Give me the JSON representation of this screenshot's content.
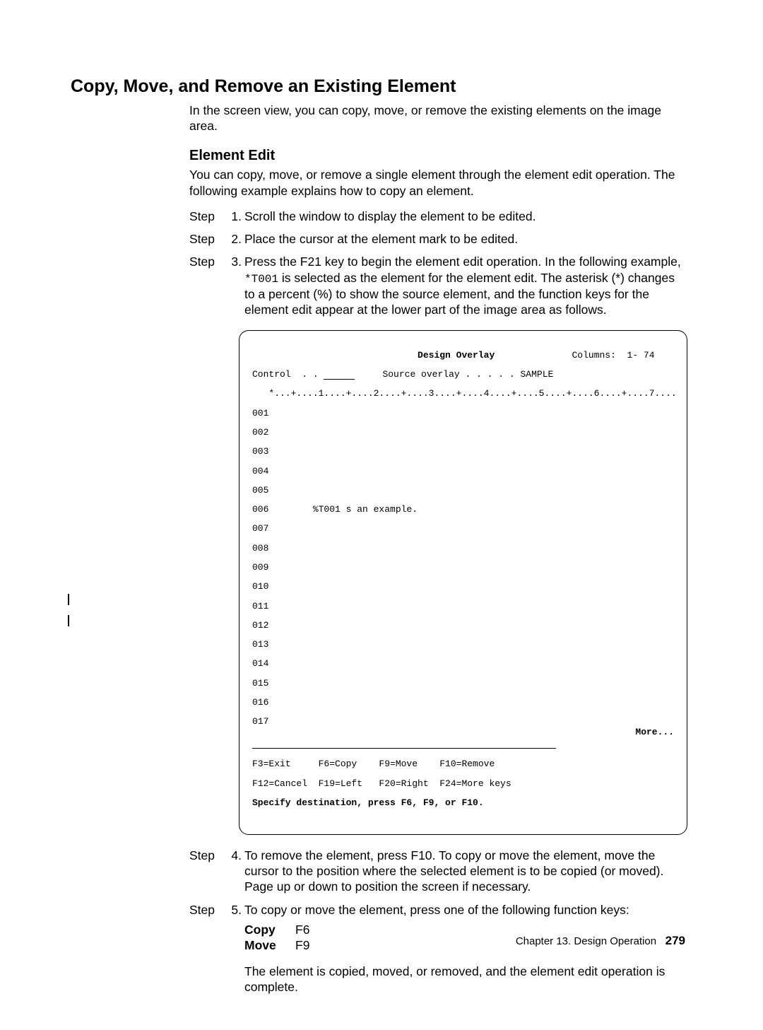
{
  "title": "Copy, Move, and Remove an Existing Element",
  "intro": "In the screen view, you can copy, move, or remove the existing elements on the image area.",
  "subhead": "Element Edit",
  "subintro": "You can copy, move, or remove a single element through the element edit operation.  The following example explains how to copy an element.",
  "step_label": "Step",
  "steps": {
    "s1": {
      "num": "1.",
      "text": "Scroll the window to display the element to be edited."
    },
    "s2": {
      "num": "2.",
      "text": "Place the cursor at the element mark to be edited."
    },
    "s3": {
      "num": "3.",
      "before": "Press the F21 key to begin the element edit operation.  In the following example, ",
      "code": "*T001",
      "after": " is selected as the element for the element edit.  The asterisk (*) changes to a percent (%) to show the source element, and the function keys for the element edit appear at the lower part of the image area as follows."
    },
    "s4": {
      "num": "4.",
      "text": "To remove the element, press F10.  To copy or move the element, move the cursor to the position where the selected element is to be copied (or moved).  Page up or down to position the screen if necessary."
    },
    "s5": {
      "num": "5.",
      "text": "To copy or move the element, press one of the following function keys:",
      "fkeys": {
        "copy": {
          "name": "Copy",
          "key": "F6"
        },
        "move": {
          "name": "Move",
          "key": "F9"
        }
      },
      "after": "The element is copied, moved, or removed, and the element edit operation is complete."
    }
  },
  "terminal": {
    "title": "Design Overlay",
    "columns_label": "Columns:",
    "columns_value": "1- 74",
    "control_label": "Control  . .",
    "source_label": "Source overlay . . . . . SAMPLE",
    "ruler": "   *...+....1....+....2....+....3....+....4....+....5....+....6....+....7....",
    "rows": [
      "001",
      "002",
      "003",
      "004",
      "005",
      "006        %T001 s an example.",
      "007",
      "008",
      "009",
      "010",
      "011",
      "012",
      "013",
      "014",
      "015",
      "016",
      "017"
    ],
    "more": "More...",
    "fkeys1": "F3=Exit     F6=Copy    F9=Move    F10=Remove",
    "fkeys2": "F12=Cancel  F19=Left   F20=Right  F24=More keys",
    "prompt": "Specify destination, press F6, F9, or F10."
  },
  "footer": {
    "chapter": "Chapter 13.  Design Operation",
    "page": "279"
  }
}
